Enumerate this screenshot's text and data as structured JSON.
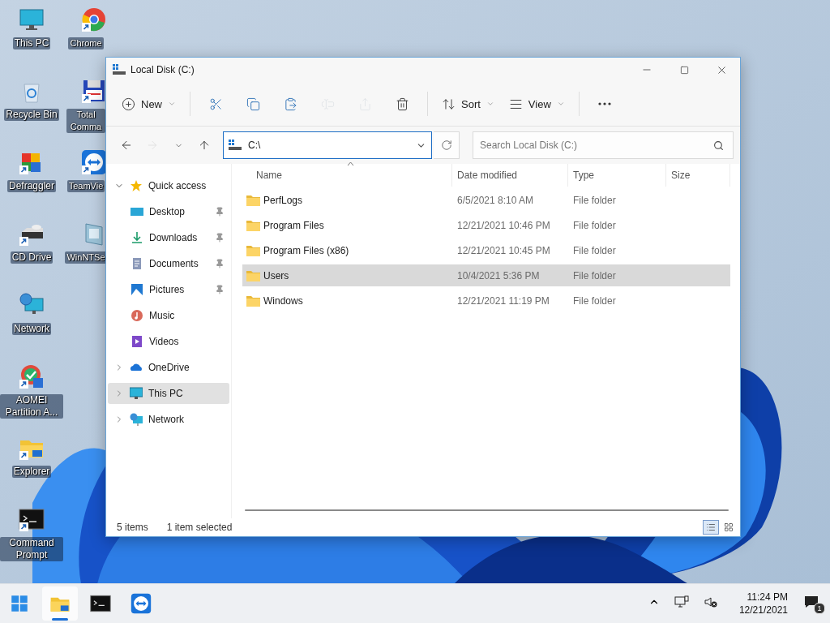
{
  "desktop": {
    "icons": [
      {
        "label": "This PC",
        "kind": "pc",
        "shortcut": false
      },
      {
        "label": "Recycle Bin",
        "kind": "recycle",
        "shortcut": false
      },
      {
        "label": "Defraggler",
        "kind": "defraggler",
        "shortcut": true
      },
      {
        "label": "CD Drive",
        "kind": "cd",
        "shortcut": true
      },
      {
        "label": "Network",
        "kind": "network",
        "shortcut": false
      },
      {
        "label": "AOMEI Partition A...",
        "kind": "aomei",
        "shortcut": true
      },
      {
        "label": "Explorer",
        "kind": "explorer",
        "shortcut": true
      },
      {
        "label": "Command Prompt",
        "kind": "cmd",
        "shortcut": true
      },
      {
        "label": "Chrome",
        "kind": "chrome",
        "shortcut": true
      },
      {
        "label": "Total Comma",
        "kind": "total",
        "shortcut": true
      },
      {
        "label": "TeamVie",
        "kind": "teamviewer",
        "shortcut": true
      },
      {
        "label": "WinNTSe",
        "kind": "winnt",
        "shortcut": false
      }
    ]
  },
  "window": {
    "title": "Local Disk (C:)",
    "toolbar": [
      {
        "kind": "new",
        "label": "New",
        "disabled": false
      },
      {
        "kind": "cut",
        "disabled": false
      },
      {
        "kind": "copy",
        "disabled": false
      },
      {
        "kind": "paste",
        "disabled": false
      },
      {
        "kind": "rename",
        "disabled": true
      },
      {
        "kind": "share",
        "disabled": true
      },
      {
        "kind": "delete",
        "disabled": false
      },
      {
        "kind": "sort",
        "label": "Sort",
        "disabled": false
      },
      {
        "kind": "view",
        "label": "View",
        "disabled": false
      },
      {
        "kind": "more",
        "disabled": false
      }
    ],
    "nav": [
      {
        "kind": "back",
        "disabled": false
      },
      {
        "kind": "forward",
        "disabled": true
      },
      {
        "kind": "recent",
        "disabled": false
      },
      {
        "kind": "up",
        "disabled": false
      }
    ],
    "address": {
      "value": "C:\\"
    },
    "search": {
      "placeholder": "Search Local Disk (C:)"
    },
    "tree": [
      {
        "label": "Quick access",
        "kind": "star",
        "expanded": true,
        "selected": false,
        "children": [
          {
            "label": "Desktop",
            "kind": "desktop",
            "pinned": true,
            "selected": false
          },
          {
            "label": "Downloads",
            "kind": "downloads",
            "pinned": true,
            "selected": false
          },
          {
            "label": "Documents",
            "kind": "documents",
            "pinned": true,
            "selected": false
          },
          {
            "label": "Pictures",
            "kind": "pictures",
            "pinned": true,
            "selected": false
          },
          {
            "label": "Music",
            "kind": "music",
            "pinned": false,
            "selected": false
          },
          {
            "label": "Videos",
            "kind": "videos",
            "pinned": false,
            "selected": false
          }
        ]
      },
      {
        "label": "OneDrive",
        "kind": "cloud",
        "expanded": false,
        "selected": false
      },
      {
        "label": "This PC",
        "kind": "pc",
        "expanded": false,
        "selected": true
      },
      {
        "label": "Network",
        "kind": "network",
        "expanded": false,
        "selected": false
      }
    ],
    "table": {
      "columns": [
        {
          "label": "Name",
          "sorted": true
        },
        {
          "label": "Date modified",
          "sorted": false
        },
        {
          "label": "Type",
          "sorted": false
        },
        {
          "label": "Size",
          "sorted": false
        }
      ],
      "rows": [
        {
          "name": "PerfLogs",
          "date": "6/5/2021 8:10 AM",
          "type": "File folder",
          "selected": false
        },
        {
          "name": "Program Files",
          "date": "12/21/2021 10:46 PM",
          "type": "File folder",
          "selected": false
        },
        {
          "name": "Program Files (x86)",
          "date": "12/21/2021 10:45 PM",
          "type": "File folder",
          "selected": false
        },
        {
          "name": "Users",
          "date": "10/4/2021 5:36 PM",
          "type": "File folder",
          "selected": true
        },
        {
          "name": "Windows",
          "date": "12/21/2021 11:19 PM",
          "type": "File folder",
          "selected": false
        }
      ]
    },
    "status_bar": {
      "count": "5 items",
      "selection": "1 item selected"
    },
    "views": [
      {
        "kind": "details",
        "selected": true
      },
      {
        "kind": "tiles",
        "selected": false
      }
    ]
  },
  "taskbar": {
    "apps": [
      {
        "kind": "start",
        "selected": false
      },
      {
        "kind": "explorer",
        "selected": true
      },
      {
        "kind": "cmd",
        "selected": false
      },
      {
        "kind": "teamviewer",
        "selected": false
      }
    ],
    "tray": {
      "time": "11:24 PM",
      "date": "12/21/2021",
      "notifications": "1"
    }
  }
}
